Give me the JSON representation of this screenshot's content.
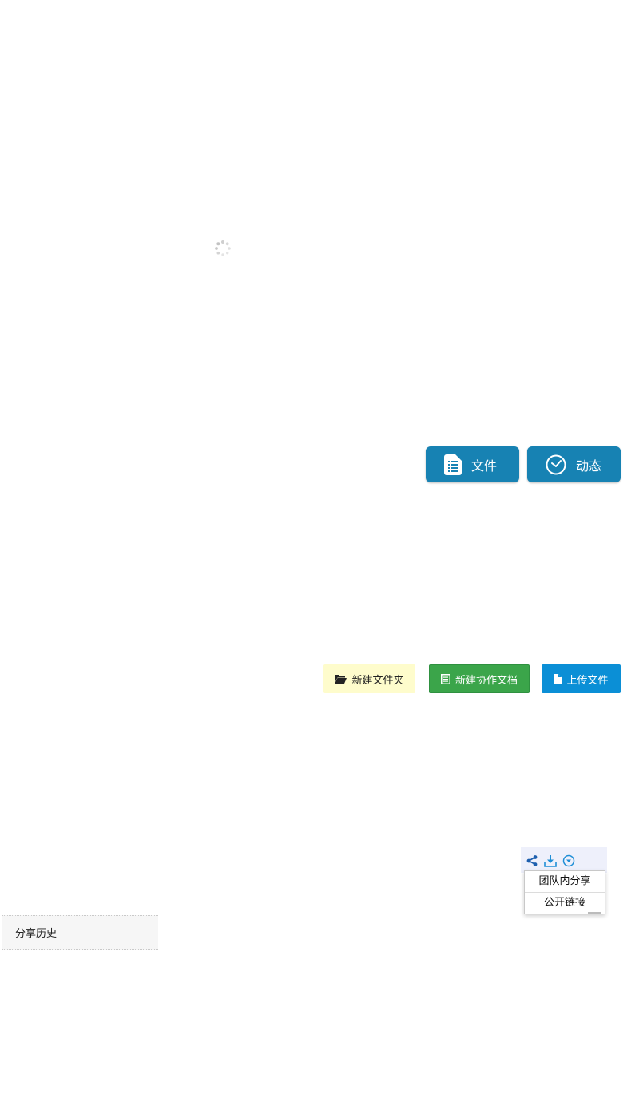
{
  "loading": {
    "icon": "loading-spinner-icon"
  },
  "tabs": {
    "files": {
      "label": "文件",
      "icon": "file-list-icon"
    },
    "activity": {
      "label": "动态",
      "icon": "clock-icon"
    },
    "color": "#1782b3"
  },
  "actions": {
    "new_folder": {
      "label": "新建文件夹",
      "icon": "folder-open-icon",
      "color": "#fefccc"
    },
    "new_collab_doc": {
      "label": "新建协作文档",
      "icon": "document-icon",
      "color": "#3ba54a"
    },
    "upload_file": {
      "label": "上传文件",
      "icon": "file-icon",
      "color": "#0b8fd6"
    }
  },
  "row_actions": {
    "share_icon": "share-icon",
    "download_icon": "download-icon",
    "more_icon": "chevron-down-circle-icon"
  },
  "share_menu": {
    "items": [
      {
        "label": "团队内分享"
      },
      {
        "label": "公开链接"
      }
    ]
  },
  "sidebar": {
    "share_history": "分享历史"
  }
}
